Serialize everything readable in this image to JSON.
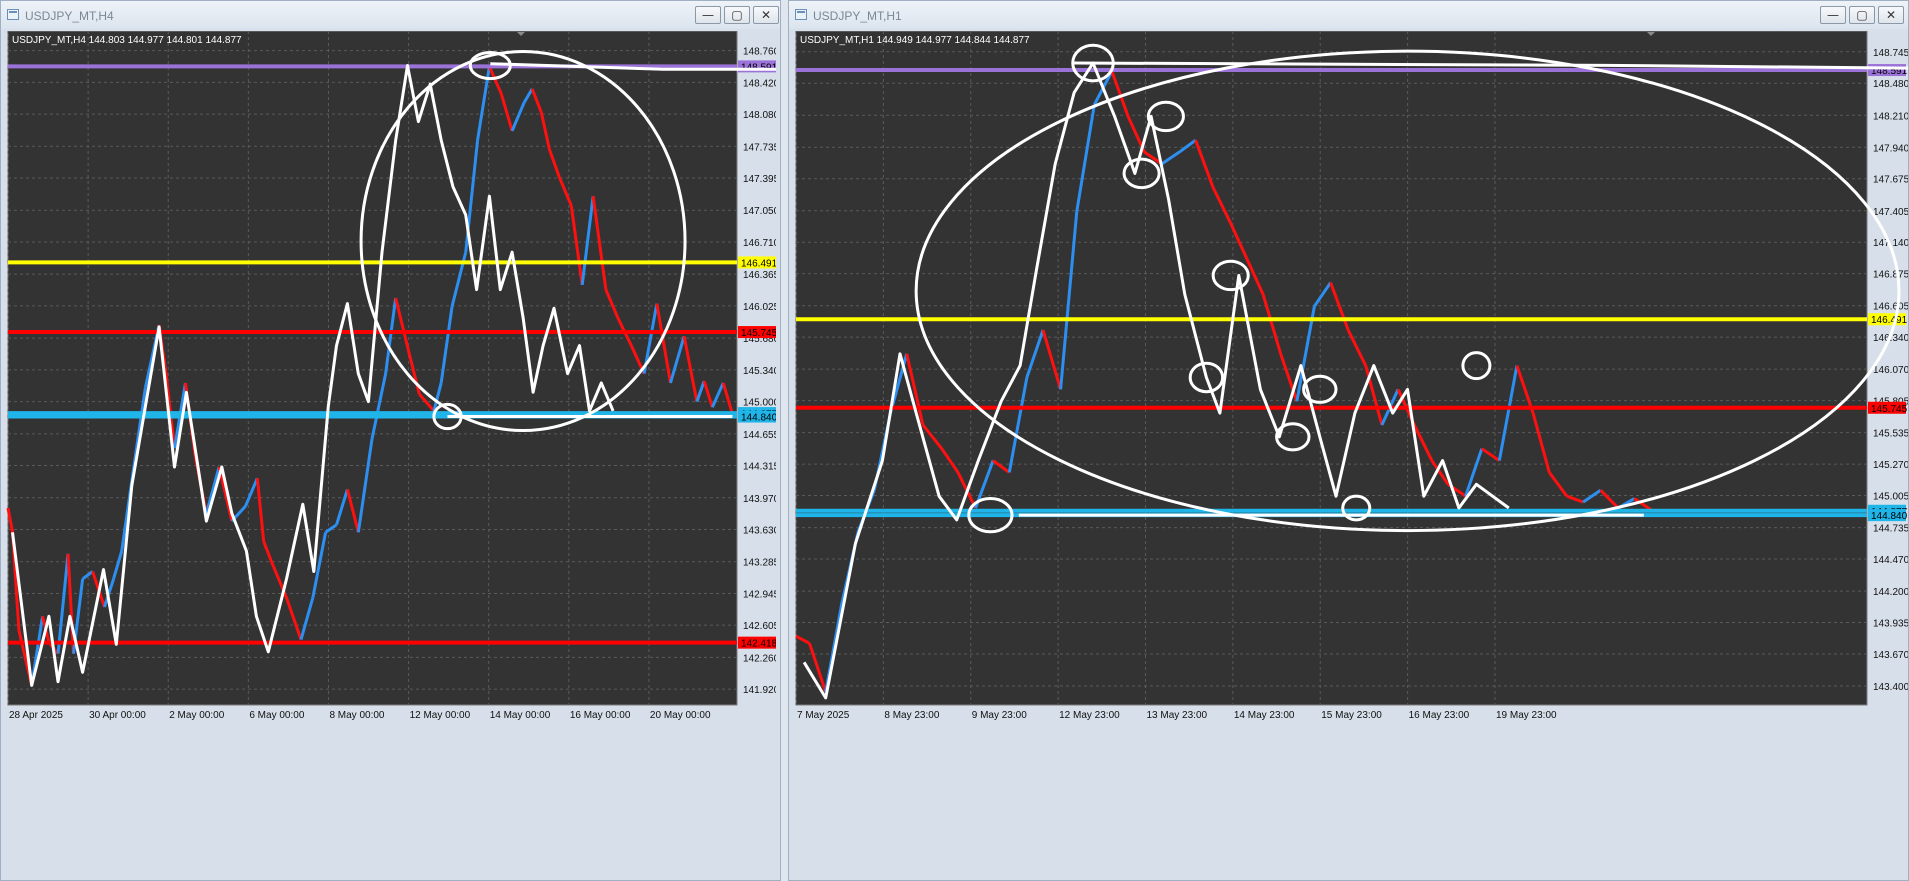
{
  "windows": [
    {
      "title": "USDJPY_MT,H4",
      "buttons": {
        "minimize": "—",
        "maximize": "▢",
        "close": "✕"
      },
      "chart_data": {
        "type": "candlestick",
        "symbol": "USDJPY_MT,H4",
        "ohlc_label": "USDJPY_MT,H4  144.803 144.977 144.801 144.877",
        "y_ticks": [
          "148.760",
          "148.420",
          "148.080",
          "147.735",
          "147.395",
          "147.050",
          "146.710",
          "146.365",
          "146.025",
          "145.680",
          "145.340",
          "145.000",
          "144.655",
          "144.315",
          "143.970",
          "143.630",
          "143.285",
          "142.945",
          "142.605",
          "142.260",
          "141.920"
        ],
        "x_ticks": [
          "28 Apr 2025",
          "30 Apr 00:00",
          "2 May 00:00",
          "6 May 00:00",
          "8 May 00:00",
          "12 May 00:00",
          "14 May 00:00",
          "16 May 00:00",
          "20 May 00:00"
        ],
        "ylim": [
          141.75,
          148.97
        ],
        "horizontal_levels": [
          {
            "price": 148.591,
            "color": "#9b72d8",
            "label": "148.591"
          },
          {
            "price": 146.491,
            "color": "#ffff00",
            "label": "146.491"
          },
          {
            "price": 145.745,
            "color": "#ff0000",
            "label": "145.745"
          },
          {
            "price": 144.877,
            "color": "#1fb5e8",
            "label": "144.877"
          },
          {
            "price": 144.84,
            "color": "#1fb5e8",
            "label": "144.840"
          },
          {
            "price": 142.418,
            "color": "#ff0000",
            "label": "142.418"
          }
        ],
        "price_path": [
          [
            0,
            143.86
          ],
          [
            0.5,
            143.6
          ],
          [
            1.2,
            142.55
          ],
          [
            2.6,
            141.96
          ],
          [
            3.8,
            142.7
          ],
          [
            4.5,
            142.42
          ],
          [
            5.5,
            142.3
          ],
          [
            6.6,
            143.37
          ],
          [
            7.2,
            142.3
          ],
          [
            8.2,
            143.1
          ],
          [
            9.3,
            143.18
          ],
          [
            10.6,
            142.8
          ],
          [
            11.6,
            143.1
          ],
          [
            12.5,
            143.4
          ],
          [
            13.6,
            144.15
          ],
          [
            15.1,
            145.15
          ],
          [
            16.6,
            145.82
          ],
          [
            17.3,
            145.35
          ],
          [
            18.3,
            144.5
          ],
          [
            19.5,
            145.2
          ],
          [
            20.6,
            144.4
          ],
          [
            21.8,
            143.8
          ],
          [
            23.2,
            144.3
          ],
          [
            24.6,
            143.72
          ],
          [
            26.1,
            143.88
          ],
          [
            27.4,
            144.18
          ],
          [
            28.1,
            143.5
          ],
          [
            29.1,
            143.25
          ],
          [
            30.6,
            142.9
          ],
          [
            32.2,
            142.45
          ],
          [
            33.5,
            142.9
          ],
          [
            34.9,
            143.6
          ],
          [
            36.1,
            143.68
          ],
          [
            37.3,
            144.06
          ],
          [
            38.5,
            143.6
          ],
          [
            40.0,
            144.6
          ],
          [
            41.5,
            145.3
          ],
          [
            42.6,
            146.11
          ],
          [
            44.0,
            145.55
          ],
          [
            45.2,
            145.08
          ],
          [
            46.8,
            144.9
          ],
          [
            47.6,
            145.2
          ],
          [
            48.8,
            146.02
          ],
          [
            50.3,
            146.6
          ],
          [
            51.6,
            147.8
          ],
          [
            52.9,
            148.59
          ],
          [
            54.2,
            148.3
          ],
          [
            55.4,
            147.9
          ],
          [
            56.7,
            148.2
          ],
          [
            57.6,
            148.35
          ],
          [
            58.6,
            148.1
          ],
          [
            59.5,
            147.7
          ],
          [
            60.6,
            147.4
          ],
          [
            61.9,
            147.1
          ],
          [
            63.1,
            146.25
          ],
          [
            64.3,
            147.2
          ],
          [
            65.7,
            146.2
          ],
          [
            67.0,
            145.9
          ],
          [
            68.5,
            145.6
          ],
          [
            69.9,
            145.3
          ],
          [
            71.3,
            146.05
          ],
          [
            72.8,
            145.2
          ],
          [
            74.3,
            145.7
          ],
          [
            75.7,
            145.0
          ],
          [
            76.5,
            145.22
          ],
          [
            77.4,
            144.94
          ],
          [
            78.6,
            145.2
          ],
          [
            79.6,
            144.87
          ]
        ],
        "drawn_lines": [
          [
            [
              0.5,
              143.6
            ],
            [
              2.6,
              141.96
            ],
            [
              4.5,
              142.7
            ],
            [
              5.5,
              142.0
            ],
            [
              6.8,
              142.7
            ],
            [
              8.2,
              142.1
            ],
            [
              10.5,
              143.2
            ],
            [
              11.9,
              142.4
            ],
            [
              13.6,
              144.1
            ],
            [
              15.1,
              144.95
            ],
            [
              16.6,
              145.8
            ],
            [
              18.3,
              144.3
            ],
            [
              19.6,
              145.1
            ],
            [
              21.8,
              143.72
            ],
            [
              23.5,
              144.3
            ],
            [
              24.6,
              143.8
            ],
            [
              26.2,
              143.4
            ],
            [
              27.3,
              142.7
            ],
            [
              28.6,
              142.32
            ],
            [
              30.6,
              143.1
            ],
            [
              32.4,
              143.9
            ],
            [
              33.6,
              143.18
            ],
            [
              35.2,
              144.95
            ],
            [
              36.1,
              145.6
            ],
            [
              37.3,
              146.05
            ],
            [
              38.5,
              145.3
            ],
            [
              39.6,
              145.0
            ],
            [
              41.1,
              146.6
            ],
            [
              42.6,
              147.8
            ],
            [
              43.9,
              148.6
            ],
            [
              45.1,
              148.0
            ],
            [
              46.4,
              148.4
            ],
            [
              47.6,
              147.8
            ],
            [
              48.9,
              147.3
            ],
            [
              50.3,
              147.0
            ],
            [
              51.5,
              146.2
            ],
            [
              52.9,
              147.2
            ],
            [
              54.1,
              146.2
            ],
            [
              55.4,
              146.6
            ],
            [
              56.6,
              145.9
            ],
            [
              57.7,
              145.1
            ],
            [
              58.8,
              145.6
            ],
            [
              60.0,
              146.0
            ],
            [
              61.5,
              145.3
            ],
            [
              62.8,
              145.6
            ],
            [
              63.9,
              144.9
            ],
            [
              65.2,
              145.2
            ],
            [
              66.5,
              144.9
            ]
          ],
          [
            [
              48.3,
              144.84
            ],
            [
              79.6,
              144.84
            ]
          ],
          [
            [
              53.0,
              148.62
            ],
            [
              72.0,
              148.56
            ],
            [
              90.0,
              148.56
            ]
          ]
        ],
        "ellipses": [
          {
            "cx": 56.6,
            "cy": 146.72,
            "rx": 17.8,
            "ry": 2.03
          },
          {
            "cx": 53.0,
            "cy": 148.6,
            "rx": 2.2,
            "ry": 0.14
          },
          {
            "cx": 48.3,
            "cy": 144.84,
            "rx": 1.5,
            "ry": 0.13
          }
        ]
      }
    },
    {
      "title": "USDJPY_MT,H1",
      "buttons": {
        "minimize": "—",
        "maximize": "▢",
        "close": "✕"
      },
      "chart_data": {
        "type": "candlestick",
        "symbol": "USDJPY_MT,H1",
        "ohlc_label": "USDJPY_MT,H1  144.949 144.977 144.844 144.877",
        "y_ticks": [
          "148.745",
          "148.480",
          "148.210",
          "147.940",
          "147.675",
          "147.405",
          "147.140",
          "146.875",
          "146.605",
          "146.340",
          "146.070",
          "145.805",
          "145.535",
          "145.270",
          "145.005",
          "144.735",
          "144.470",
          "144.200",
          "143.935",
          "143.670",
          "143.400"
        ],
        "x_ticks": [
          "7 May 2025",
          "8 May 23:00",
          "9 May 23:00",
          "12 May 23:00",
          "13 May 23:00",
          "14 May 23:00",
          "15 May 23:00",
          "16 May 23:00",
          "19 May 23:00"
        ],
        "ylim": [
          143.24,
          148.92
        ],
        "horizontal_levels": [
          {
            "price": 148.591,
            "color": "#9b72d8",
            "label": "148.591"
          },
          {
            "price": 146.491,
            "color": "#ffff00",
            "label": "146.491"
          },
          {
            "price": 145.745,
            "color": "#ff0000",
            "label": "145.745"
          },
          {
            "price": 144.877,
            "color": "#1fb5e8",
            "label": "144.877"
          },
          {
            "price": 144.84,
            "color": "#1fb5e8",
            "label": "144.840"
          }
        ],
        "price_path": [
          [
            0,
            143.82
          ],
          [
            1.0,
            143.76
          ],
          [
            2.2,
            143.35
          ],
          [
            3.4,
            144.1
          ],
          [
            4.6,
            144.7
          ],
          [
            5.8,
            145.05
          ],
          [
            7.0,
            145.7
          ],
          [
            8.2,
            146.2
          ],
          [
            9.4,
            145.6
          ],
          [
            10.8,
            145.4
          ],
          [
            12.0,
            145.2
          ],
          [
            13.3,
            144.9
          ],
          [
            14.6,
            145.3
          ],
          [
            15.8,
            145.2
          ],
          [
            17.1,
            146.0
          ],
          [
            18.3,
            146.4
          ],
          [
            19.6,
            145.9
          ],
          [
            20.8,
            147.4
          ],
          [
            22.1,
            148.3
          ],
          [
            23.4,
            148.58
          ],
          [
            24.6,
            148.2
          ],
          [
            25.8,
            147.9
          ],
          [
            27.1,
            147.8
          ],
          [
            28.4,
            147.9
          ],
          [
            29.6,
            148.0
          ],
          [
            30.9,
            147.6
          ],
          [
            32.2,
            147.3
          ],
          [
            33.4,
            147.0
          ],
          [
            34.6,
            146.7
          ],
          [
            35.9,
            146.2
          ],
          [
            37.1,
            145.8
          ],
          [
            38.4,
            146.6
          ],
          [
            39.6,
            146.8
          ],
          [
            40.9,
            146.4
          ],
          [
            42.2,
            146.1
          ],
          [
            43.4,
            145.6
          ],
          [
            44.6,
            145.9
          ],
          [
            45.8,
            145.6
          ],
          [
            47.1,
            145.3
          ],
          [
            48.3,
            145.1
          ],
          [
            49.6,
            145.0
          ],
          [
            50.8,
            145.4
          ],
          [
            52.1,
            145.3
          ],
          [
            53.4,
            146.1
          ],
          [
            54.6,
            145.7
          ],
          [
            55.8,
            145.2
          ],
          [
            57.1,
            145.0
          ],
          [
            58.3,
            144.95
          ],
          [
            59.6,
            145.05
          ],
          [
            60.9,
            144.9
          ],
          [
            62.1,
            144.98
          ],
          [
            63.4,
            144.88
          ]
        ],
        "drawn_lines": [
          [
            [
              0.6,
              143.6
            ],
            [
              2.2,
              143.3
            ],
            [
              4.4,
              144.6
            ],
            [
              6.4,
              145.3
            ],
            [
              7.7,
              146.2
            ],
            [
              8.9,
              145.7
            ],
            [
              10.6,
              145.0
            ],
            [
              11.9,
              144.8
            ],
            [
              13.5,
              145.3
            ],
            [
              15.2,
              145.8
            ],
            [
              16.6,
              146.1
            ],
            [
              17.8,
              146.9
            ],
            [
              19.2,
              147.8
            ],
            [
              20.6,
              148.4
            ],
            [
              22.0,
              148.65
            ],
            [
              23.6,
              148.2
            ],
            [
              25.1,
              147.72
            ],
            [
              26.3,
              148.2
            ],
            [
              27.6,
              147.5
            ],
            [
              28.8,
              146.7
            ],
            [
              30.4,
              146.0
            ],
            [
              31.4,
              145.7
            ],
            [
              32.8,
              146.86
            ],
            [
              34.4,
              145.9
            ],
            [
              35.8,
              145.5
            ],
            [
              37.4,
              146.1
            ],
            [
              38.8,
              145.5
            ],
            [
              40.0,
              145.0
            ],
            [
              41.4,
              145.7
            ],
            [
              42.8,
              146.1
            ],
            [
              44.2,
              145.7
            ],
            [
              45.3,
              145.9
            ],
            [
              46.5,
              145.0
            ],
            [
              47.9,
              145.3
            ],
            [
              49.1,
              144.9
            ],
            [
              50.4,
              145.1
            ],
            [
              51.6,
              145.0
            ],
            [
              52.8,
              144.9
            ]
          ],
          [
            [
              16.5,
              144.84
            ],
            [
              62.8,
              144.84
            ]
          ],
          [
            [
              20.6,
              148.65
            ],
            [
              60.0,
              148.63
            ],
            [
              90.0,
              148.6
            ]
          ]
        ],
        "ellipses": [
          {
            "cx": 45.3,
            "cy": 146.73,
            "rx": 36.4,
            "ry": 2.02
          },
          {
            "cx": 22.0,
            "cy": 148.65,
            "rx": 1.5,
            "ry": 0.15
          },
          {
            "cx": 27.4,
            "cy": 148.2,
            "rx": 1.3,
            "ry": 0.12
          },
          {
            "cx": 25.6,
            "cy": 147.72,
            "rx": 1.3,
            "ry": 0.12
          },
          {
            "cx": 32.2,
            "cy": 146.86,
            "rx": 1.3,
            "ry": 0.12
          },
          {
            "cx": 30.4,
            "cy": 146.0,
            "rx": 1.2,
            "ry": 0.12
          },
          {
            "cx": 38.8,
            "cy": 145.9,
            "rx": 1.2,
            "ry": 0.11
          },
          {
            "cx": 36.8,
            "cy": 145.5,
            "rx": 1.2,
            "ry": 0.11
          },
          {
            "cx": 41.5,
            "cy": 144.9,
            "rx": 1.0,
            "ry": 0.1
          },
          {
            "cx": 50.4,
            "cy": 146.1,
            "rx": 1.0,
            "ry": 0.11
          },
          {
            "cx": 14.4,
            "cy": 144.84,
            "rx": 1.6,
            "ry": 0.14
          }
        ]
      }
    }
  ]
}
